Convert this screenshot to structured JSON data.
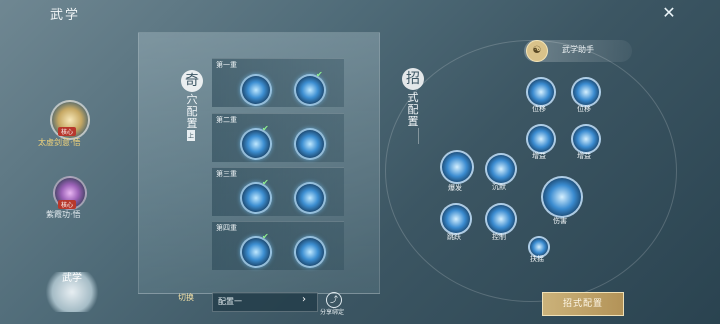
{
  "header": {
    "title": "武学",
    "close_icon": "close-x-icon"
  },
  "left_skills": [
    {
      "name": "太虚剑意·悟",
      "tag": "核心",
      "icon": "swirl-skill-icon"
    },
    {
      "name": "紫霞功·悟",
      "tag": "核心",
      "icon": "purple-skill-icon"
    }
  ],
  "qixue": {
    "char": "奇",
    "label": "穴配置",
    "sub": "上"
  },
  "zhaoshi": {
    "char": "招",
    "label": "式配置"
  },
  "tiers": [
    {
      "label": "第一重",
      "skills": [
        {
          "icon": "blue-skill-icon",
          "checked": false
        },
        {
          "icon": "blue-skill-icon",
          "checked": true
        }
      ]
    },
    {
      "label": "第二重",
      "skills": [
        {
          "icon": "blue-skill-icon",
          "checked": true
        },
        {
          "icon": "blue-skill-icon",
          "checked": false
        }
      ]
    },
    {
      "label": "第三重",
      "skills": [
        {
          "icon": "blue-skill-icon",
          "checked": true
        },
        {
          "icon": "blue-skill-icon",
          "checked": false
        }
      ]
    },
    {
      "label": "第四重",
      "skills": [
        {
          "icon": "blue-skill-icon",
          "checked": true
        },
        {
          "icon": "blue-skill-icon",
          "checked": false
        }
      ]
    }
  ],
  "helper": {
    "label": "武学助手"
  },
  "nodes": [
    {
      "label": "位移"
    },
    {
      "label": "位移"
    },
    {
      "label": "增益"
    },
    {
      "label": "增益"
    },
    {
      "label": "爆发"
    },
    {
      "label": "沉默"
    },
    {
      "label": "伤害"
    },
    {
      "label": "跳跃"
    },
    {
      "label": "控制"
    },
    {
      "label": "扶摇"
    }
  ],
  "footer": {
    "swap": "切换",
    "config_value": "配置一",
    "share": "分享绑定",
    "button": "招式配置",
    "logo": "武学"
  }
}
